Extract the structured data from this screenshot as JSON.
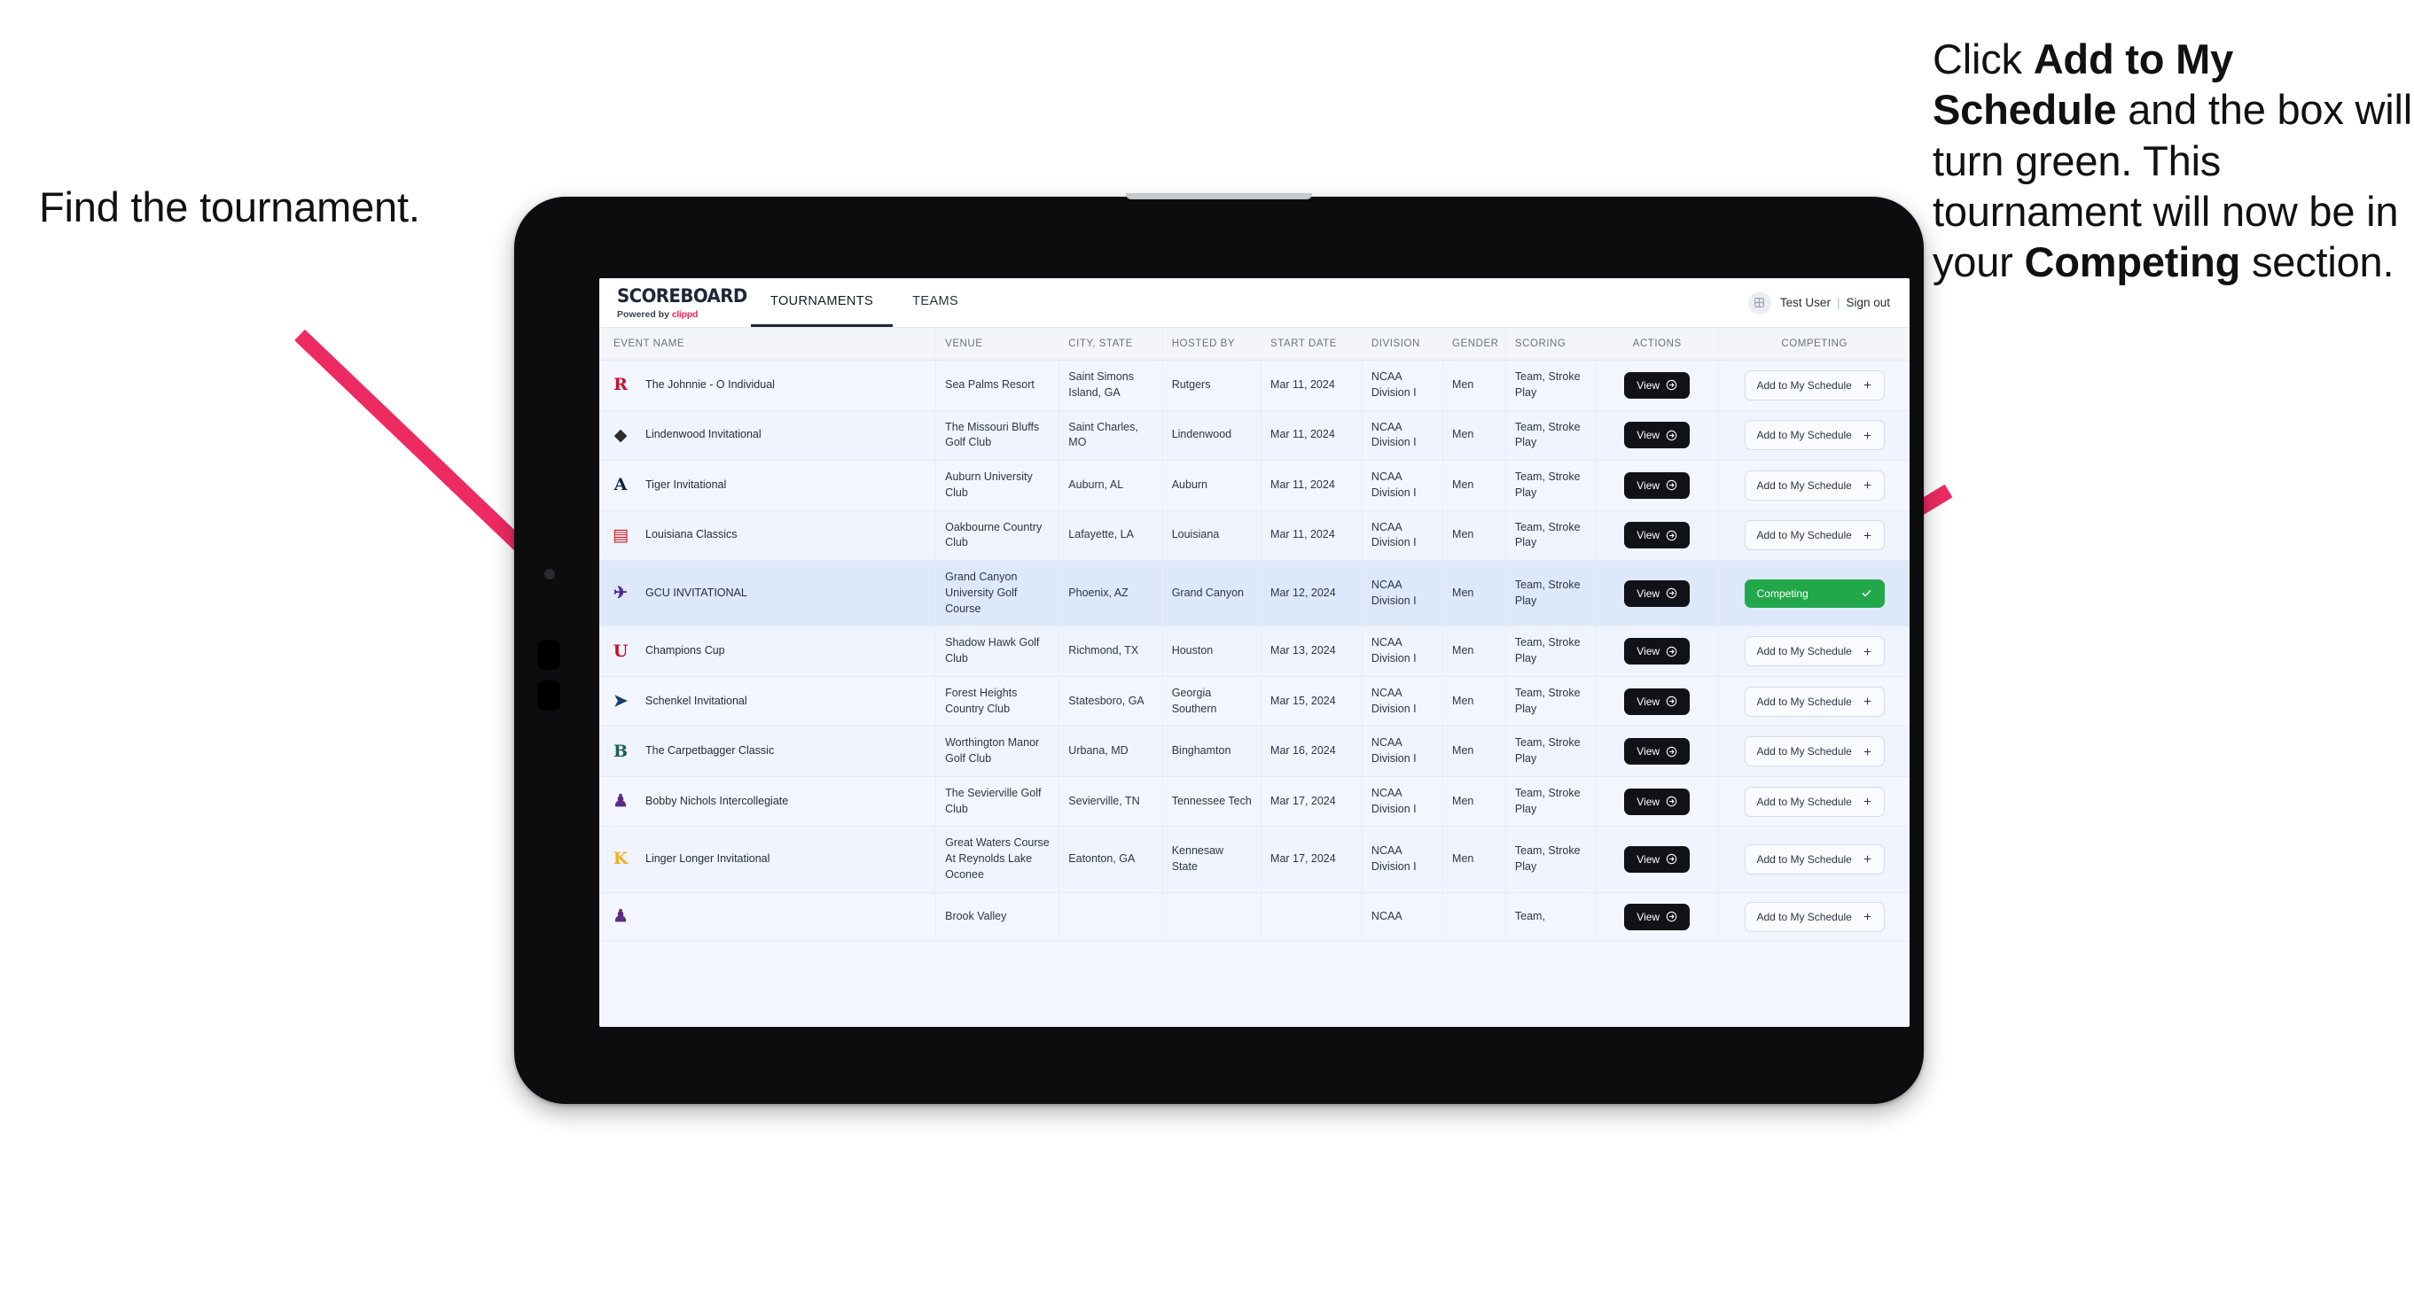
{
  "annotations": {
    "left": "Find the tournament.",
    "right_parts": [
      {
        "text": "Click ",
        "bold": false
      },
      {
        "text": "Add to My Schedule",
        "bold": true
      },
      {
        "text": " and the box will turn green. This tournament will now be in your ",
        "bold": false
      },
      {
        "text": "Competing",
        "bold": true
      },
      {
        "text": " section.",
        "bold": false
      }
    ],
    "arrow_color": "#ee2a63"
  },
  "app": {
    "brand": {
      "title": "SCOREBOARD",
      "powered_prefix": "Powered by ",
      "powered_name": "clippd",
      "clippd_color": "#f0285c"
    },
    "tabs": [
      {
        "label": "TOURNAMENTS",
        "active": true
      },
      {
        "label": "TEAMS",
        "active": false
      }
    ],
    "user": {
      "name": "Test User",
      "separator": "|",
      "sign_out": "Sign out",
      "avatar_icon": "user-avatar-icon"
    },
    "table": {
      "columns": [
        "EVENT NAME",
        "VENUE",
        "CITY, STATE",
        "HOSTED BY",
        "START DATE",
        "DIVISION",
        "GENDER",
        "SCORING",
        "ACTIONS",
        "COMPETING"
      ],
      "action_label": "View",
      "add_label": "Add to My Schedule",
      "add_icon": "plus-icon",
      "competing_label": "Competing",
      "competing_icon": "check-icon",
      "competing_color": "#22a84a",
      "rows": [
        {
          "event": "The Johnnie - O Individual",
          "logo": {
            "glyph": "R",
            "color": "#c8102e",
            "bg": "transparent"
          },
          "venue": "Sea Palms Resort",
          "city": "Saint Simons Island, GA",
          "host": "Rutgers",
          "date": "Mar 11, 2024",
          "division": "NCAA Division I",
          "gender": "Men",
          "scoring": "Team, Stroke Play",
          "competing": false
        },
        {
          "event": "Lindenwood Invitational",
          "logo": {
            "glyph": "◆",
            "color": "#2c2c2c",
            "bg": "transparent"
          },
          "venue": "The Missouri Bluffs Golf Club",
          "city": "Saint Charles, MO",
          "host": "Lindenwood",
          "date": "Mar 11, 2024",
          "division": "NCAA Division I",
          "gender": "Men",
          "scoring": "Team, Stroke Play",
          "competing": false
        },
        {
          "event": "Tiger Invitational",
          "logo": {
            "glyph": "A",
            "color": "#0c2340",
            "bg": "transparent"
          },
          "venue": "Auburn University Club",
          "city": "Auburn, AL",
          "host": "Auburn",
          "date": "Mar 11, 2024",
          "division": "NCAA Division I",
          "gender": "Men",
          "scoring": "Team, Stroke Play",
          "competing": false
        },
        {
          "event": "Louisiana Classics",
          "logo": {
            "glyph": "▤",
            "color": "#ce181e",
            "bg": "transparent"
          },
          "venue": "Oakbourne Country Club",
          "city": "Lafayette, LA",
          "host": "Louisiana",
          "date": "Mar 11, 2024",
          "division": "NCAA Division I",
          "gender": "Men",
          "scoring": "Team, Stroke Play",
          "competing": false
        },
        {
          "event": "GCU INVITATIONAL",
          "logo": {
            "glyph": "✈",
            "color": "#522398",
            "bg": "transparent"
          },
          "venue": "Grand Canyon University Golf Course",
          "city": "Phoenix, AZ",
          "host": "Grand Canyon",
          "date": "Mar 12, 2024",
          "division": "NCAA Division I",
          "gender": "Men",
          "scoring": "Team, Stroke Play",
          "competing": true
        },
        {
          "event": "Champions Cup",
          "logo": {
            "glyph": "U",
            "color": "#c8102e",
            "bg": "transparent"
          },
          "venue": "Shadow Hawk Golf Club",
          "city": "Richmond, TX",
          "host": "Houston",
          "date": "Mar 13, 2024",
          "division": "NCAA Division I",
          "gender": "Men",
          "scoring": "Team, Stroke Play",
          "competing": false
        },
        {
          "event": "Schenkel Invitational",
          "logo": {
            "glyph": "➤",
            "color": "#133e6b",
            "bg": "transparent"
          },
          "venue": "Forest Heights Country Club",
          "city": "Statesboro, GA",
          "host": "Georgia Southern",
          "date": "Mar 15, 2024",
          "division": "NCAA Division I",
          "gender": "Men",
          "scoring": "Team, Stroke Play",
          "competing": false
        },
        {
          "event": "The Carpetbagger Classic",
          "logo": {
            "glyph": "B",
            "color": "#1b5e52",
            "bg": "transparent"
          },
          "venue": "Worthington Manor Golf Club",
          "city": "Urbana, MD",
          "host": "Binghamton",
          "date": "Mar 16, 2024",
          "division": "NCAA Division I",
          "gender": "Men",
          "scoring": "Team, Stroke Play",
          "competing": false
        },
        {
          "event": "Bobby Nichols Intercollegiate",
          "logo": {
            "glyph": "♟",
            "color": "#582c83",
            "bg": "transparent"
          },
          "venue": "The Sevierville Golf Club",
          "city": "Sevierville, TN",
          "host": "Tennessee Tech",
          "date": "Mar 17, 2024",
          "division": "NCAA Division I",
          "gender": "Men",
          "scoring": "Team, Stroke Play",
          "competing": false
        },
        {
          "event": "Linger Longer Invitational",
          "logo": {
            "glyph": "K",
            "color": "#f0b323",
            "bg": "transparent"
          },
          "venue": "Great Waters Course At Reynolds Lake Oconee",
          "city": "Eatonton, GA",
          "host": "Kennesaw State",
          "date": "Mar 17, 2024",
          "division": "NCAA Division I",
          "gender": "Men",
          "scoring": "Team, Stroke Play",
          "competing": false
        },
        {
          "event": "",
          "logo": {
            "glyph": "♟",
            "color": "#582c83",
            "bg": "transparent"
          },
          "venue": "Brook Valley",
          "city": "",
          "host": "",
          "date": "",
          "division": "NCAA",
          "gender": "",
          "scoring": "Team,",
          "competing": false
        }
      ]
    }
  }
}
